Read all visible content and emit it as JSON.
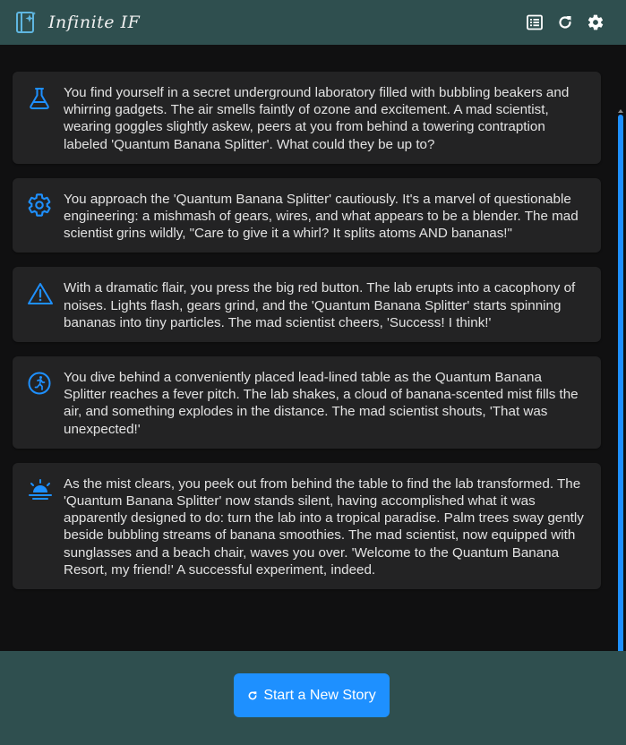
{
  "header": {
    "title": "Infinite IF",
    "icons": [
      "logo-book-sparkle-icon",
      "list-icon",
      "refresh-icon",
      "gear-icon"
    ]
  },
  "story": {
    "passages": [
      {
        "icon": "flask-icon",
        "text": "You find yourself in a secret underground laboratory filled with bubbling beakers and whirring gadgets. The air smells faintly of ozone and excitement. A mad scientist, wearing goggles slightly askew, peers at you from behind a towering contraption labeled 'Quantum Banana Splitter'. What could they be up to?"
      },
      {
        "icon": "gear-icon",
        "text": "You approach the 'Quantum Banana Splitter' cautiously. It's a marvel of questionable engineering: a mishmash of gears, wires, and what appears to be a blender. The mad scientist grins wildly, \"Care to give it a whirl? It splits atoms AND bananas!\""
      },
      {
        "icon": "warning-icon",
        "text": "With a dramatic flair, you press the big red button. The lab erupts into a cacophony of noises. Lights flash, gears grind, and the 'Quantum Banana Splitter' starts spinning bananas into tiny particles. The mad scientist cheers, 'Success! I think!'"
      },
      {
        "icon": "running-person-icon",
        "text": "You dive behind a conveniently placed lead-lined table as the Quantum Banana Splitter reaches a fever pitch. The lab shakes, a cloud of banana-scented mist fills the air, and something explodes in the distance. The mad scientist shouts, 'That was unexpected!'"
      },
      {
        "icon": "sunrise-icon",
        "text": "As the mist clears, you peek out from behind the table to find the lab transformed. The 'Quantum Banana Splitter' now stands silent, having accomplished what it was apparently designed to do: turn the lab into a tropical paradise. Palm trees sway gently beside bubbling streams of banana smoothies. The mad scientist, now equipped with sunglasses and a beach chair, waves you over. 'Welcome to the Quantum Banana Resort, my friend!' A successful experiment, indeed."
      }
    ]
  },
  "footer": {
    "new_story_label": "Start a New Story",
    "new_story_icon": "refresh-icon"
  },
  "colors": {
    "accent": "#1e90ff",
    "header_bg": "#2f4f4f",
    "page_bg": "#101011",
    "card_bg": "#232324"
  }
}
